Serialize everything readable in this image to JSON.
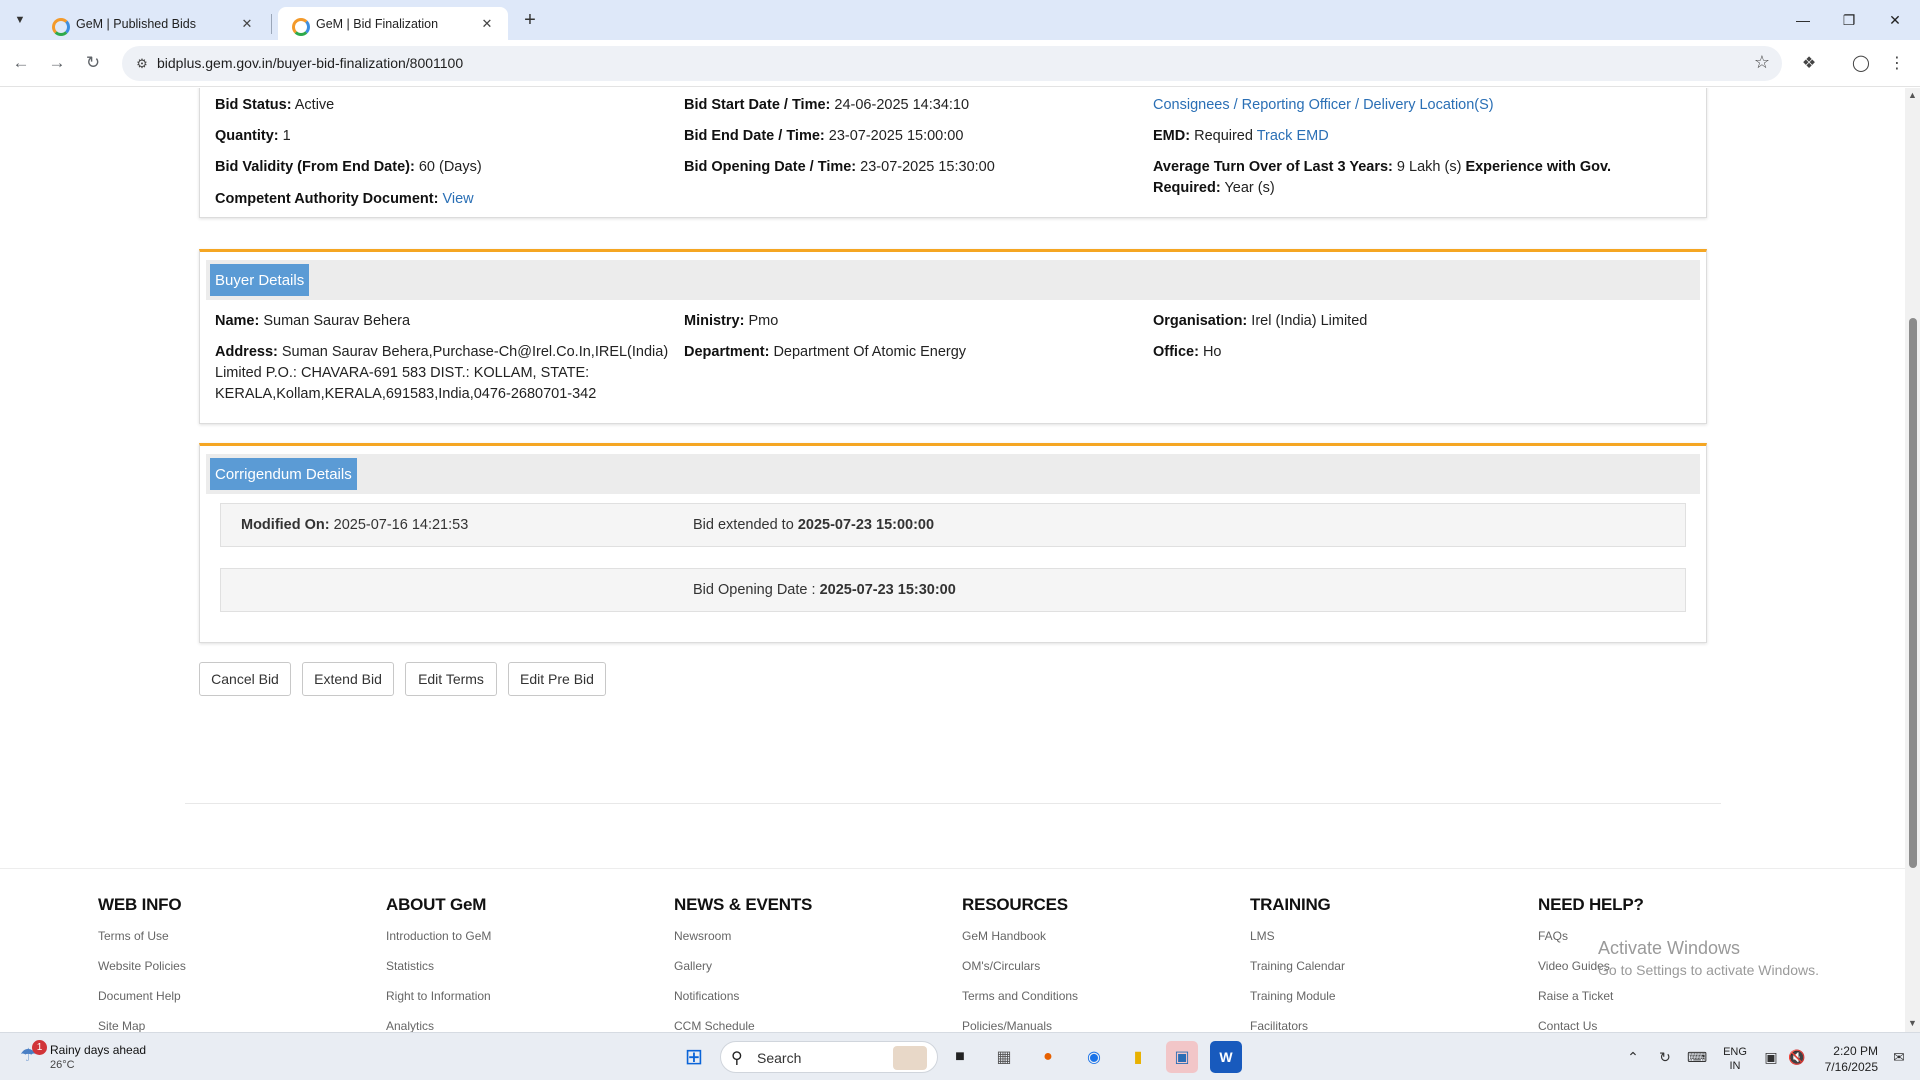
{
  "browser": {
    "tabs": [
      {
        "title": "GeM | Published Bids",
        "active": false
      },
      {
        "title": "GeM | Bid Finalization",
        "active": true
      }
    ],
    "url": "bidplus.gem.gov.in/buyer-bid-finalization/8001100"
  },
  "bid_info": {
    "col1": [
      {
        "label": "Bid Status:",
        "value": "Active"
      },
      {
        "label": "Quantity:",
        "value": "1"
      },
      {
        "label": "Bid Validity (From End Date):",
        "value": "60 (Days)"
      },
      {
        "label": "Competent Authority Document:",
        "link": "View"
      }
    ],
    "col2": [
      {
        "label": "Bid Start Date / Time:",
        "value": "24-06-2025 14:34:10"
      },
      {
        "label": "Bid End Date / Time:",
        "value": "23-07-2025 15:00:00"
      },
      {
        "label": "Bid Opening Date / Time:",
        "value": "23-07-2025 15:30:00"
      }
    ],
    "col3": {
      "consignees_link": "Consignees / Reporting Officer / Delivery Location(S)",
      "emd_label": "EMD:",
      "emd_value": "Required",
      "emd_link": "Track EMD",
      "turnover_label": "Average Turn Over of Last 3 Years:",
      "turnover_value": "9 Lakh (s)",
      "experience_label": "Experience with Gov.",
      "required_label": "Required:",
      "experience_value": "Year (s)"
    }
  },
  "buyer_details": {
    "heading": "Buyer Details",
    "name_label": "Name:",
    "name_value": "Suman Saurav Behera",
    "address_label": "Address:",
    "address_line1": "Suman Saurav Behera,Purchase-Ch@Irel.Co.In,IREL(India)",
    "address_line2": "Limited P.O.: CHAVARA-691 583 DIST.: KOLLAM, STATE:",
    "address_line3": "KERALA,Kollam,KERALA,691583,India,0476-2680701-342",
    "ministry_label": "Ministry:",
    "ministry_value": "Pmo",
    "department_label": "Department:",
    "department_value": "Department Of Atomic Energy",
    "organisation_label": "Organisation:",
    "organisation_value": "Irel (India) Limited",
    "office_label": "Office:",
    "office_value": "Ho"
  },
  "corrigendum": {
    "heading": "Corrigendum Details",
    "modified_label": "Modified On:",
    "modified_value": "2025-07-16 14:21:53",
    "extended_prefix": "Bid extended to",
    "extended_value": "2025-07-23 15:00:00",
    "opening_prefix": "Bid Opening Date :",
    "opening_value": "2025-07-23 15:30:00"
  },
  "actions": {
    "cancel": "Cancel Bid",
    "extend": "Extend Bid",
    "edit_terms": "Edit Terms",
    "edit_pre_bid": "Edit Pre Bid"
  },
  "footer": {
    "columns": [
      {
        "heading": "WEB INFO",
        "links": [
          "Terms of Use",
          "Website Policies",
          "Document Help",
          "Site Map"
        ]
      },
      {
        "heading": "ABOUT GeM",
        "links": [
          "Introduction to GeM",
          "Statistics",
          "Right to Information",
          "Analytics"
        ]
      },
      {
        "heading": "NEWS & EVENTS",
        "links": [
          "Newsroom",
          "Gallery",
          "Notifications",
          "CCM Schedule"
        ]
      },
      {
        "heading": "RESOURCES",
        "links": [
          "GeM Handbook",
          "OM's/Circulars",
          "Terms and Conditions",
          "Policies/Manuals"
        ]
      },
      {
        "heading": "TRAINING",
        "links": [
          "LMS",
          "Training Calendar",
          "Training Module",
          "Facilitators"
        ]
      },
      {
        "heading": "NEED HELP?",
        "links": [
          "FAQs",
          "Video Guides",
          "Raise a Ticket",
          "Contact Us"
        ]
      }
    ]
  },
  "watermark": {
    "line1": "Activate Windows",
    "line2": "Go to Settings to activate Windows."
  },
  "taskbar": {
    "weather_badge": "1",
    "weather_text": "Rainy days ahead",
    "weather_temp": "26°C",
    "search_placeholder": "Search",
    "lang_line1": "ENG",
    "lang_line2": "IN",
    "time": "2:20 PM",
    "date": "7/16/2025"
  },
  "colors": {
    "accent_orange": "#f5a623",
    "section_label_blue": "#5b9bd5",
    "link_blue": "#2a6fb5"
  }
}
